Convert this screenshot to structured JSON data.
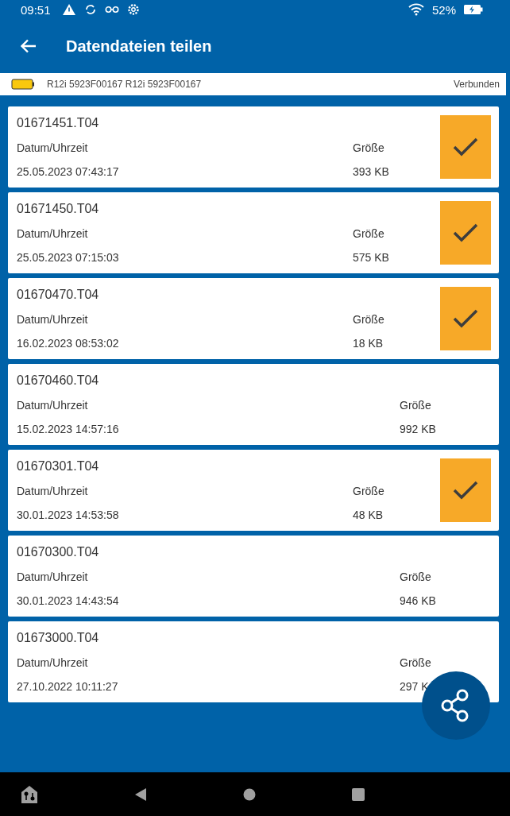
{
  "status_bar": {
    "time": "09:51",
    "battery": "52%"
  },
  "app_bar": {
    "title": "Datendateien teilen"
  },
  "device": {
    "name": "R12i  5923F00167  R12i 5923F00167",
    "status": "Verbunden"
  },
  "files": [
    {
      "name": "01671451.T04",
      "date_label": "Datum/Uhrzeit",
      "date": "25.05.2023 07:43:17",
      "size_label": "Größe",
      "size": "393 KB",
      "selected": true
    },
    {
      "name": "01671450.T04",
      "date_label": "Datum/Uhrzeit",
      "date": "25.05.2023 07:15:03",
      "size_label": "Größe",
      "size": "575 KB",
      "selected": true
    },
    {
      "name": "01670470.T04",
      "date_label": "Datum/Uhrzeit",
      "date": "16.02.2023 08:53:02",
      "size_label": "Größe",
      "size": "18 KB",
      "selected": true
    },
    {
      "name": "01670460.T04",
      "date_label": "Datum/Uhrzeit",
      "date": "15.02.2023 14:57:16",
      "size_label": "Größe",
      "size": "992 KB",
      "selected": false
    },
    {
      "name": "01670301.T04",
      "date_label": "Datum/Uhrzeit",
      "date": "30.01.2023 14:53:58",
      "size_label": "Größe",
      "size": "48 KB",
      "selected": true
    },
    {
      "name": "01670300.T04",
      "date_label": "Datum/Uhrzeit",
      "date": "30.01.2023 14:43:54",
      "size_label": "Größe",
      "size": "946 KB",
      "selected": false
    },
    {
      "name": "01673000.T04",
      "date_label": "Datum/Uhrzeit",
      "date": "27.10.2022 10:11:27",
      "size_label": "Größe",
      "size": "297 K",
      "selected": false
    }
  ]
}
